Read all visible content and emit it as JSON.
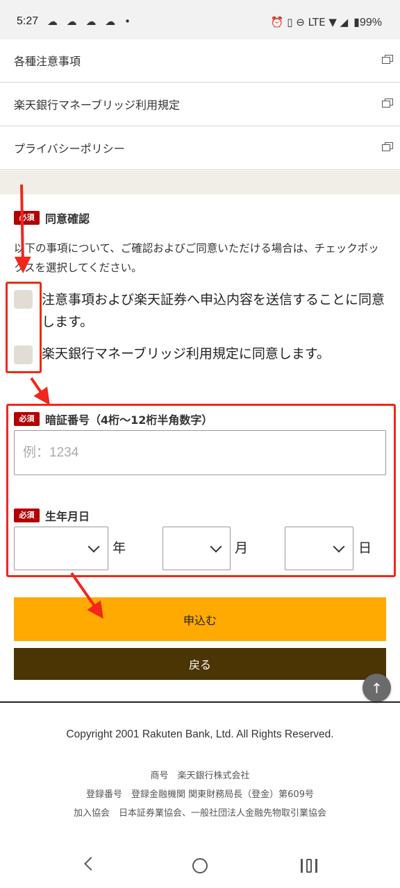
{
  "status_bar": {
    "time": "5:27",
    "app_icons": "☁ ☁ ☁ ☁ •",
    "indicators": "⏰ ▯ ⊖ LTE ▼ ◢",
    "battery": "▮99%"
  },
  "links": [
    {
      "label": "各種注意事項",
      "icon": "external-window-icon"
    },
    {
      "label": "楽天銀行マネーブリッジ利用規定",
      "icon": "external-window-icon"
    },
    {
      "label": "プライバシーポリシー",
      "icon": "external-window-icon"
    }
  ],
  "consent": {
    "badge": "必須",
    "title": "同意確認",
    "notice": "以下の事項について、ご確認およびご同意いただける場合は、チェックボックスを選択してください。",
    "items": [
      {
        "label": "注意事項および楽天証券へ申込内容を送信することに同意します。",
        "checked": false
      },
      {
        "label": "楽天銀行マネーブリッジ利用規定に同意します。",
        "checked": false
      }
    ]
  },
  "pin": {
    "badge": "必須",
    "title": "暗証番号（4桁〜12桁半角数字）",
    "placeholder": "例：1234",
    "value": ""
  },
  "birthdate": {
    "badge": "必須",
    "title": "生年月日",
    "year_unit": "年",
    "month_unit": "月",
    "day_unit": "日",
    "year_value": "",
    "month_value": "",
    "day_value": ""
  },
  "buttons": {
    "apply": "申込む",
    "back": "戻る",
    "scroll_top": "↑"
  },
  "colors": {
    "apply_button": "#ffaa00",
    "back_button": "#4b3505",
    "required_badge": "#b30000",
    "annotation": "#f2261a"
  },
  "footer": {
    "copyright": "Copyright 2001 Rakuten Bank, Ltd. All Rights Reserved.",
    "trade_name": "商号　楽天銀行株式会社",
    "registration": "登録番号　登録金融機関 関東財務局長（登金）第609号",
    "associations": "加入協会　日本証券業協会、一般社団法人金融先物取引業協会"
  }
}
